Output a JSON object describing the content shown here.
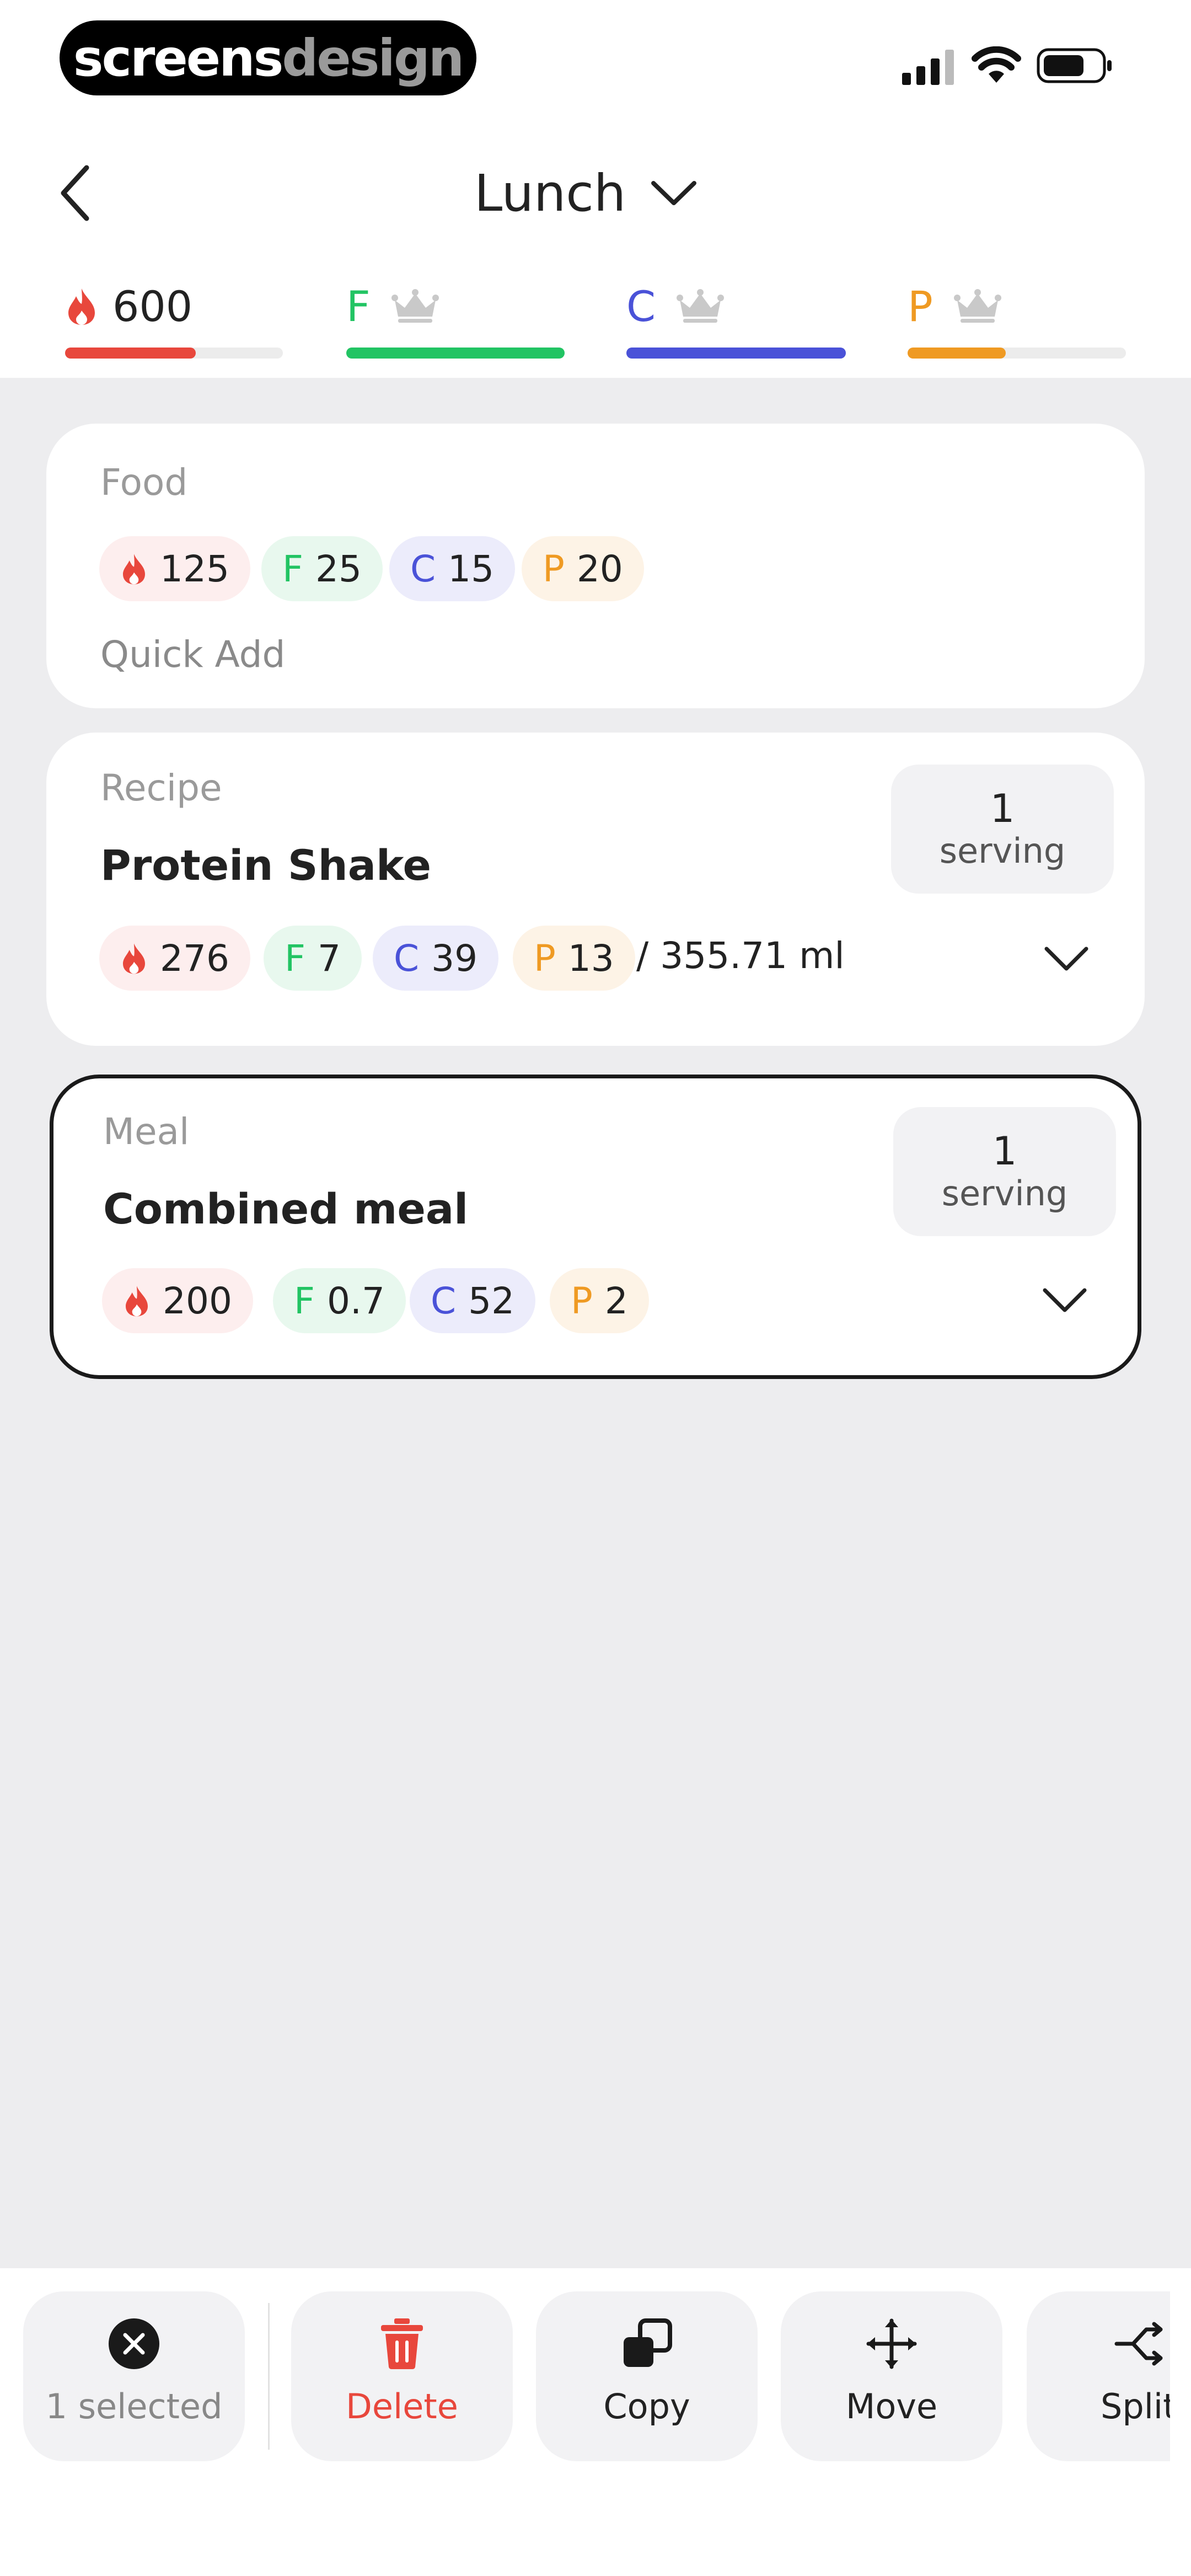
{
  "status_bar": {
    "brand_part1": "screens",
    "brand_part2": "design"
  },
  "header": {
    "title": "Lunch"
  },
  "macros": {
    "calories": {
      "value": "600",
      "progress": 0.6,
      "color": "#e8473c"
    },
    "fat": {
      "letter": "F",
      "progress": 1.0,
      "color": "#22c463"
    },
    "carbs": {
      "letter": "C",
      "progress": 1.0,
      "color": "#4a52d8"
    },
    "protein": {
      "letter": "P",
      "progress": 0.45,
      "color": "#ef9a23"
    }
  },
  "cards": [
    {
      "label": "Food",
      "pills": {
        "cal": "125",
        "f_letter": "F",
        "f": "25",
        "c_letter": "C",
        "c": "15",
        "p_letter": "P",
        "p": "20"
      },
      "subtitle": "Quick Add"
    },
    {
      "label": "Recipe",
      "title": "Protein Shake",
      "serving_num": "1",
      "serving_unit": "serving",
      "pills": {
        "cal": "276",
        "f_letter": "F",
        "f": "7",
        "c_letter": "C",
        "c": "39",
        "p_letter": "P",
        "p": "13"
      },
      "volume": "/ 355.71 ml"
    },
    {
      "label": "Meal",
      "title": "Combined meal",
      "serving_num": "1",
      "serving_unit": "serving",
      "pills": {
        "cal": "200",
        "f_letter": "F",
        "f": "0.7",
        "c_letter": "C",
        "c": "52",
        "p_letter": "P",
        "p": "2"
      },
      "selected": true
    }
  ],
  "actions": {
    "selected_label": "1 selected",
    "delete_label": "Delete",
    "copy_label": "Copy",
    "move_label": "Move",
    "split_label": "Split"
  },
  "colors": {
    "calorie": "#e8473c",
    "fat": "#22c463",
    "carbs": "#4a52d8",
    "protein": "#ef9a23",
    "delete": "#e8473c"
  }
}
